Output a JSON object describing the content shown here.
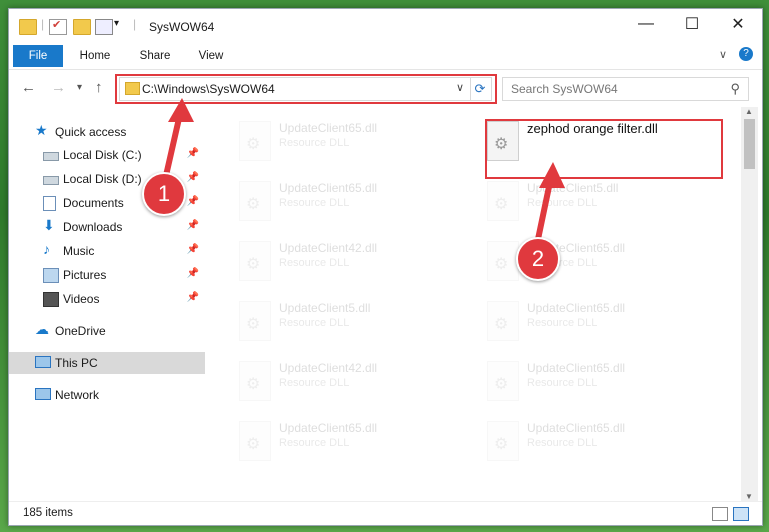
{
  "window": {
    "title": "SysWOW64"
  },
  "ribbon": {
    "tabs": [
      "File",
      "Home",
      "Share",
      "View"
    ]
  },
  "address": {
    "path": "C:\\Windows\\SysWOW64"
  },
  "search": {
    "placeholder": "Search SysWOW64"
  },
  "sidebar": {
    "items": [
      {
        "label": "Quick access",
        "icon": "star-icon"
      },
      {
        "label": "Local Disk (C:)",
        "icon": "drive-icon",
        "pinned": true
      },
      {
        "label": "Local Disk (D:)",
        "icon": "drive-icon",
        "pinned": true
      },
      {
        "label": "Documents",
        "icon": "documents-icon",
        "pinned": true
      },
      {
        "label": "Downloads",
        "icon": "downloads-icon",
        "pinned": true
      },
      {
        "label": "Music",
        "icon": "music-icon",
        "pinned": true
      },
      {
        "label": "Pictures",
        "icon": "pictures-icon",
        "pinned": true
      },
      {
        "label": "Videos",
        "icon": "videos-icon",
        "pinned": true
      },
      {
        "label": "OneDrive",
        "icon": "cloud-icon"
      },
      {
        "label": "This PC",
        "icon": "pc-icon",
        "selected": true
      },
      {
        "label": "Network",
        "icon": "network-icon"
      }
    ]
  },
  "files": {
    "highlighted": {
      "name": "zephod orange filter.dll"
    },
    "left": [
      {
        "name": "UpdateClient65.dll",
        "type": "Resource DLL"
      },
      {
        "name": "UpdateClient65.dll",
        "type": "Resource DLL"
      },
      {
        "name": "UpdateClient42.dll",
        "type": "Resource DLL"
      },
      {
        "name": "UpdateClient5.dll",
        "type": "Resource DLL"
      },
      {
        "name": "UpdateClient42.dll",
        "type": "Resource DLL"
      },
      {
        "name": "UpdateClient65.dll",
        "type": "Resource DLL"
      }
    ],
    "right": [
      {
        "name": "UpdateClient5.dll",
        "type": "Resource DLL"
      },
      {
        "name": "UpdateClient65.dll",
        "type": "Resource DLL"
      },
      {
        "name": "UpdateClient65.dll",
        "type": "Resource DLL"
      },
      {
        "name": "UpdateClient65.dll",
        "type": "Resource DLL"
      },
      {
        "name": "UpdateClient65.dll",
        "type": "Resource DLL"
      }
    ]
  },
  "status": {
    "items": "185 items"
  },
  "annotations": {
    "step1": "1",
    "step2": "2",
    "color": "#e0393e"
  }
}
